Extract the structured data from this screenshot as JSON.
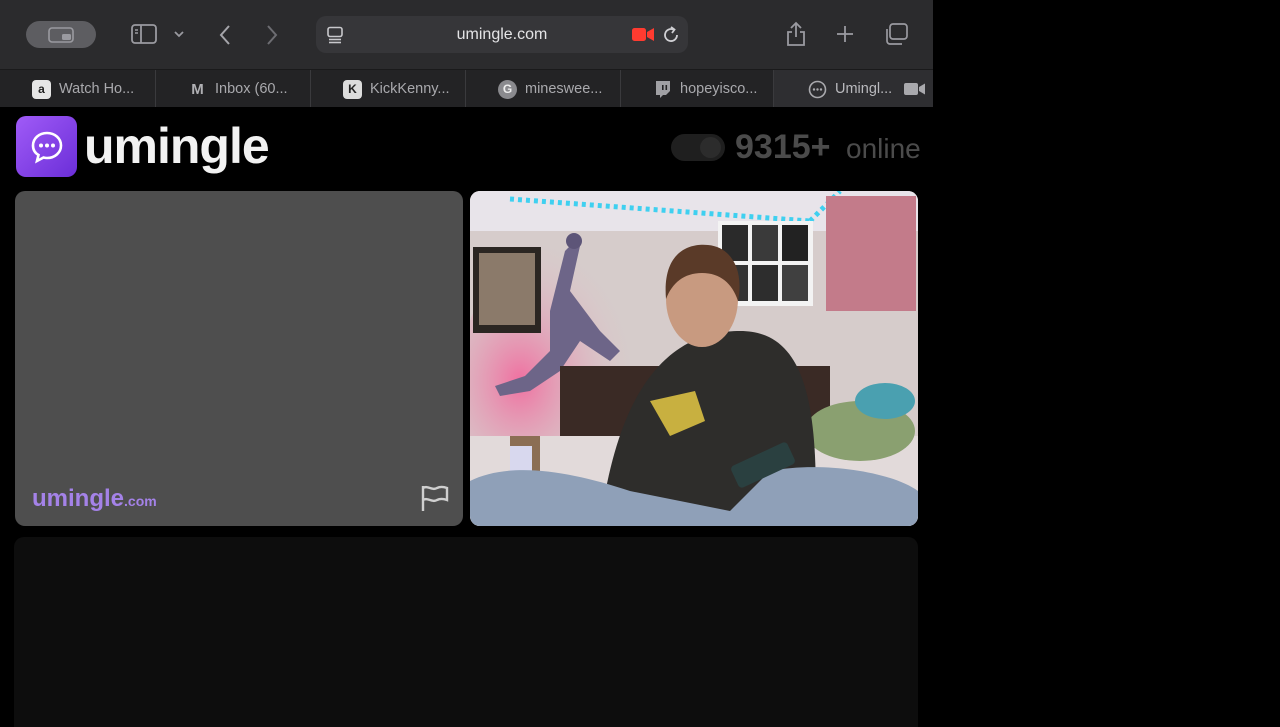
{
  "browser": {
    "url": "umingle.com",
    "tabs": [
      {
        "label": "Watch Ho...",
        "icon": "amazon-icon"
      },
      {
        "label": "Inbox (60...",
        "icon": "gmail-icon"
      },
      {
        "label": "KickKenny...",
        "icon": "kick-icon"
      },
      {
        "label": "minesweе...",
        "icon": "google-icon"
      },
      {
        "label": "hopeyisco...",
        "icon": "twitch-icon"
      },
      {
        "label": "Umingl...",
        "icon": "umingle-icon"
      }
    ]
  },
  "site": {
    "brand": "umingle",
    "online_count": "9315+",
    "online_label": "online",
    "watermark": "umingle",
    "watermark_tld": ".com"
  },
  "colors": {
    "accent": "#8b45f0",
    "watermark": "#a482e8",
    "recording": "#ff3b30"
  }
}
